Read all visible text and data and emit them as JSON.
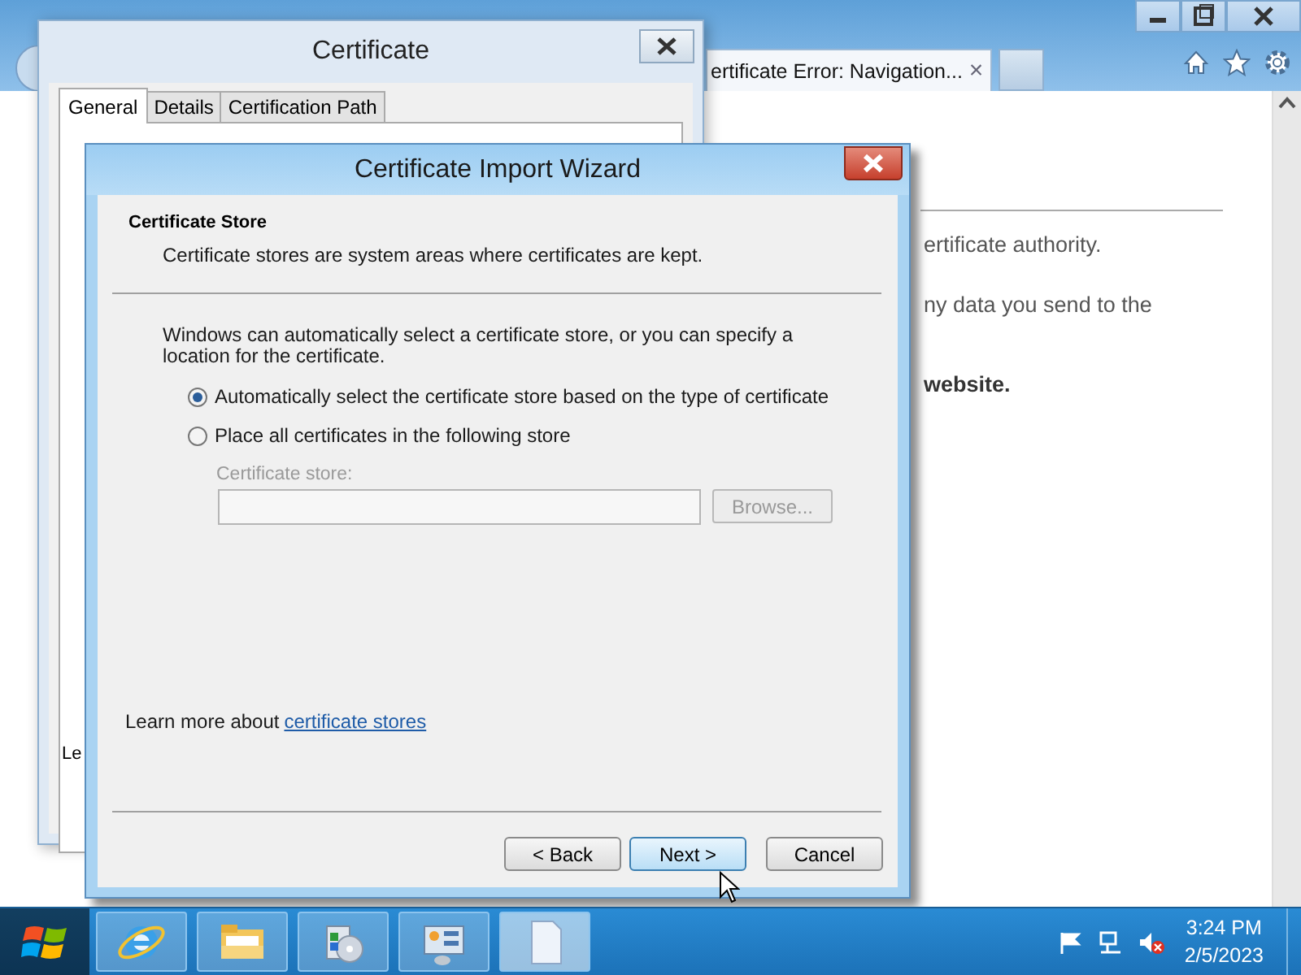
{
  "browser": {
    "tab": {
      "title": "ertificate Error: Navigation...",
      "close": "×"
    },
    "page_lines": [
      {
        "text": "ertificate authority.",
        "strong": false
      },
      {
        "text": "ny data you send to the",
        "strong": false
      },
      {
        "text": "website.",
        "strong": true
      }
    ]
  },
  "certificate_dialog": {
    "title": "Certificate",
    "tabs": [
      {
        "label": "General",
        "selected": true
      },
      {
        "label": "Details",
        "selected": false
      },
      {
        "label": "Certification Path",
        "selected": false
      }
    ],
    "panel_text": "Le"
  },
  "wizard": {
    "title": "Certificate Import Wizard",
    "heading": "Certificate Store",
    "subtitle": "Certificate stores are system areas where certificates are kept.",
    "description": "Windows can automatically select a certificate store, or you can specify a location for the certificate.",
    "options": [
      {
        "label": "Automatically select the certificate store based on the type of certificate",
        "selected": true
      },
      {
        "label": "Place all certificates in the following store",
        "selected": false
      }
    ],
    "store_field": {
      "label": "Certificate store:",
      "disabled": true
    },
    "browse_button": {
      "label": "Browse...",
      "disabled": true
    },
    "learn_more": {
      "text": "Learn more about",
      "link": "certificate stores"
    },
    "buttons": [
      {
        "label": "< Back",
        "default": false
      },
      {
        "label": "Next >",
        "default": true
      },
      {
        "label": "Cancel",
        "default": false
      }
    ]
  },
  "taskbar": {
    "apps": [
      {
        "kind": "browser",
        "active": false
      },
      {
        "kind": "folder",
        "active": false
      },
      {
        "kind": "installer",
        "active": false
      },
      {
        "kind": "control-panel",
        "active": false
      },
      {
        "kind": "document",
        "active": true
      }
    ],
    "time": "3:24 PM",
    "date": "2/5/2023"
  }
}
